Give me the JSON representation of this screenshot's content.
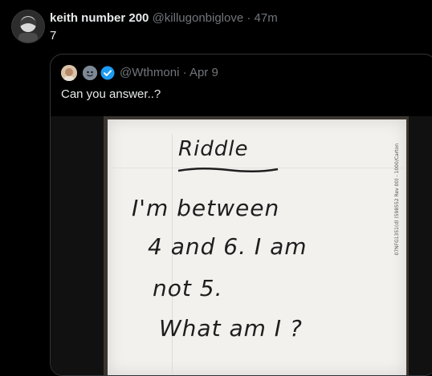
{
  "tweet": {
    "author_name": "keith number 200",
    "author_handle": "@killugonbiglove",
    "separator": "·",
    "time": "47m",
    "text": "7"
  },
  "quoted": {
    "handle": "@Wthmoni",
    "separator": "·",
    "date": "Apr 9",
    "text": "Can you answer..?"
  },
  "photo_note": {
    "title": "Riddle",
    "lines": [
      "I'm between",
      "4 and 6. I am",
      "not 5.",
      "What am I ?"
    ],
    "side_print": "07NFG1351(d) (598552 Rev 00) - 1000/Carton"
  },
  "colors": {
    "background": "#000000",
    "text": "#e7e9ea",
    "secondary": "#71767b",
    "border": "#2f3336",
    "verified": "#1d9bf0"
  },
  "icons": [
    "user-avatar-icon",
    "quoted-avatar-icon",
    "secondary-avatar-icon",
    "verified-badge-icon"
  ]
}
